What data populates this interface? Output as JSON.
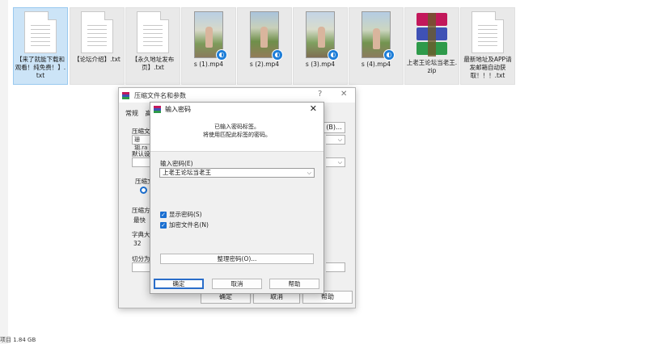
{
  "files": [
    {
      "name": "【来了就能下载和观看！纯免费！】.txt",
      "type": "txt",
      "selected": true
    },
    {
      "name": "【论坛介绍】.txt",
      "type": "txt",
      "selected": false
    },
    {
      "name": "【永久地址发布页】.txt",
      "type": "txt",
      "selected": false
    },
    {
      "name": "s (1).mp4",
      "type": "mp4",
      "selected": false
    },
    {
      "name": "s (2).mp4",
      "type": "mp4",
      "selected": false
    },
    {
      "name": "s (3).mp4",
      "type": "mp4",
      "selected": false
    },
    {
      "name": "s (4).mp4",
      "type": "mp4",
      "selected": false
    },
    {
      "name": "上老王论坛当老王.zip",
      "type": "zip",
      "selected": false
    },
    {
      "name": "最新地址及APP请发邮箱自动获取！！！.txt",
      "type": "txt",
      "selected": false
    }
  ],
  "statusbar": {
    "text": "项目 1.84 GB"
  },
  "back_dialog": {
    "title": "压缩文件名和参数",
    "help_glyph": "?",
    "close_glyph": "✕",
    "tab_general": "常规",
    "tab_second": "高",
    "label_archive_name": "压缩文",
    "field_archive_name": "珊瑚.ra",
    "browse_label": "(B)...",
    "label_default": "默认设",
    "label_format": "压缩文",
    "label_method": "压缩方",
    "method_value": "最快",
    "label_dict": "字典大小",
    "dict_value": "32",
    "label_split": "切分为分",
    "ok": "确定",
    "cancel": "取消",
    "help": "帮助"
  },
  "dialog": {
    "title": "输入密码",
    "close_glyph": "✕",
    "info_line1": "已输入密码标签。",
    "info_line2": "将使用匹配此标签的密码。",
    "password_label": "输入密码(E)",
    "password_value": "上老王论坛当老王",
    "show_password": "显示密码(S)",
    "encrypt_filenames": "加密文件名(N)",
    "manage_button": "整理密码(O)...",
    "ok": "确定",
    "cancel": "取消",
    "help": "帮助"
  },
  "colors": {
    "accent": "#1a6fd1",
    "selection": "#cce4f7"
  }
}
